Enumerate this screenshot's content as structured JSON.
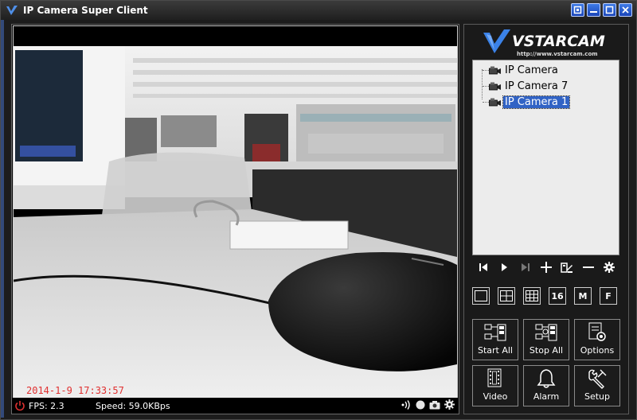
{
  "window": {
    "title": "IP Camera Super Client"
  },
  "video": {
    "timestamp": "2014-1-9 17:33:57",
    "fps": "FPS: 2.3",
    "speed": "Speed: 59.0KBps"
  },
  "brand": {
    "logo_text": "VSTARCAM",
    "url": "http://www.vstarcam.com"
  },
  "camera_tree": {
    "items": [
      {
        "label": "IP Camera",
        "selected": false
      },
      {
        "label": "IP Camera 7",
        "selected": false
      },
      {
        "label": "IP Camera 1",
        "selected": true
      }
    ]
  },
  "layout_buttons": {
    "sixteen": "16",
    "m": "M",
    "f": "F"
  },
  "buttons": {
    "start_all": "Start All",
    "stop_all": "Stop All",
    "options": "Options",
    "video": "Video",
    "alarm": "Alarm",
    "setup": "Setup"
  },
  "colors": {
    "timestamp": "#e03030",
    "selection": "#3163c5",
    "titlebar_button": "#2a5fd0"
  }
}
